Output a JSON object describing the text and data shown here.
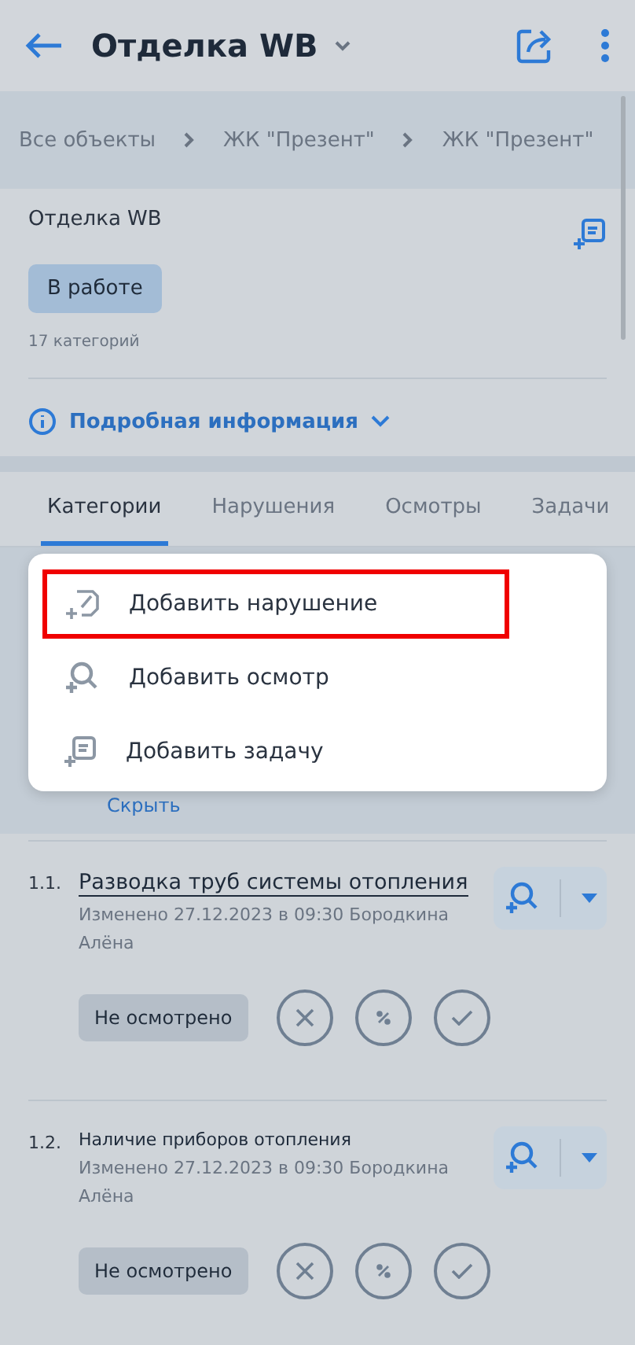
{
  "header": {
    "title": "Отделка WB"
  },
  "breadcrumbs": [
    "Все объекты",
    "ЖК \"Презент\"",
    "ЖК \"Презент\""
  ],
  "card": {
    "title": "Отделка WB",
    "status": "В работе",
    "count": "17 категорий",
    "details_link": "Подробная информация"
  },
  "tabs": [
    {
      "label": "Категории",
      "selected": true
    },
    {
      "label": "Нарушения",
      "selected": false
    },
    {
      "label": "Осмотры",
      "selected": false
    },
    {
      "label": "Задачи",
      "selected": false
    }
  ],
  "hide_link": "Скрыть",
  "items": [
    {
      "number": "1.1.",
      "title": "Разводка труб системы отопления",
      "selected": true,
      "meta": "Изменено 27.12.2023 в 09:30 Бородкина Алёна",
      "status": "Не осмотрено"
    },
    {
      "number": "1.2.",
      "title": "Наличие приборов отопления",
      "selected": false,
      "meta": "Изменено 27.12.2023 в 09:30 Бородкина Алёна",
      "status": "Не осмотрено"
    }
  ],
  "menu": [
    {
      "kind": "violation",
      "label": "Добавить нарушение",
      "highlighted": true
    },
    {
      "kind": "inspection",
      "label": "Добавить осмотр",
      "highlighted": false
    },
    {
      "kind": "task",
      "label": "Добавить задачу",
      "highlighted": false
    }
  ]
}
